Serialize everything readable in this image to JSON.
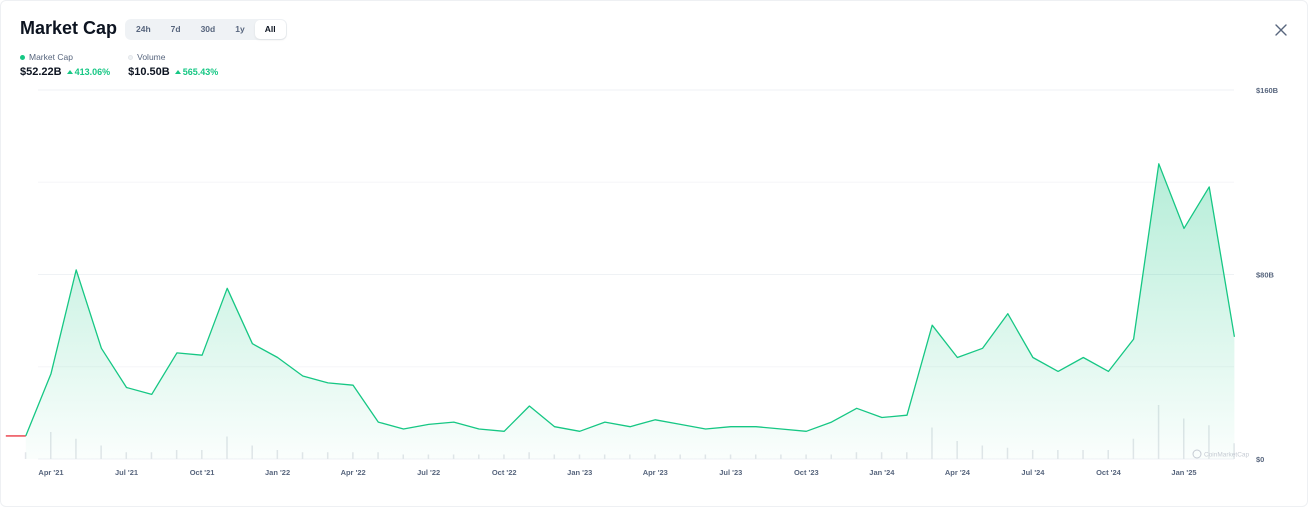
{
  "header": {
    "title": "Market Cap",
    "tabs": [
      {
        "label": "24h",
        "active": false
      },
      {
        "label": "7d",
        "active": false
      },
      {
        "label": "30d",
        "active": false
      },
      {
        "label": "1y",
        "active": false
      },
      {
        "label": "All",
        "active": true
      }
    ]
  },
  "stats": {
    "market_cap": {
      "label": "Market Cap",
      "value": "$52.22B",
      "change": "413.06%",
      "dot_color": "#16c784"
    },
    "volume": {
      "label": "Volume",
      "value": "$10.50B",
      "change": "565.43%",
      "dot_color": "#eff2f5"
    }
  },
  "watermark": "CoinMarketCap",
  "colors": {
    "up": "#16c784",
    "down": "#ea3943",
    "volume": "#e3e6ea",
    "grid": "#eff2f5"
  },
  "chart_data": {
    "type": "area",
    "x_ticks": [
      "Apr '21",
      "Jul '21",
      "Oct '21",
      "Jan '22",
      "Apr '22",
      "Jul '22",
      "Oct '22",
      "Jan '23",
      "Apr '23",
      "Jul '23",
      "Oct '23",
      "Jan '24",
      "Apr '24",
      "Jul '24",
      "Oct '24",
      "Jan '25"
    ],
    "y_ticks": [
      {
        "label": "$160B",
        "value": 160
      },
      {
        "label": "$80B",
        "value": 80
      },
      {
        "label": "$0",
        "value": 0
      }
    ],
    "ylim": [
      0,
      160
    ],
    "x": [
      "2021-03",
      "2021-04",
      "2021-05",
      "2021-06",
      "2021-07",
      "2021-08",
      "2021-09",
      "2021-10",
      "2021-11",
      "2021-12",
      "2022-01",
      "2022-02",
      "2022-03",
      "2022-04",
      "2022-05",
      "2022-06",
      "2022-07",
      "2022-08",
      "2022-09",
      "2022-10",
      "2022-11",
      "2022-12",
      "2023-01",
      "2023-02",
      "2023-03",
      "2023-04",
      "2023-05",
      "2023-06",
      "2023-07",
      "2023-08",
      "2023-09",
      "2023-10",
      "2023-11",
      "2023-12",
      "2024-01",
      "2024-02",
      "2024-03",
      "2024-04",
      "2024-05",
      "2024-06",
      "2024-07",
      "2024-08",
      "2024-09",
      "2024-10",
      "2024-11",
      "2024-12",
      "2025-01",
      "2025-02",
      "2025-03"
    ],
    "series": [
      {
        "values": [
          10,
          37,
          82,
          48,
          31,
          28,
          46,
          45,
          74,
          50,
          44,
          36,
          33,
          32,
          16,
          13,
          15,
          16,
          13,
          12,
          23,
          14,
          12,
          16,
          14,
          17,
          15,
          13,
          14,
          14,
          13,
          12,
          16,
          22,
          18,
          19,
          58,
          44,
          48,
          63,
          44,
          38,
          44,
          38,
          52,
          128,
          100,
          118,
          53
        ]
      }
    ],
    "volume": [
      3,
      12,
      9,
      6,
      3,
      3,
      4,
      4,
      10,
      6,
      4,
      3,
      3,
      3,
      3,
      2,
      2,
      2,
      2,
      2,
      3,
      2,
      2,
      2,
      2,
      2,
      2,
      2,
      2,
      2,
      2,
      2,
      2,
      3,
      3,
      3,
      14,
      8,
      6,
      5,
      4,
      4,
      4,
      4,
      9,
      24,
      18,
      15,
      7
    ]
  }
}
